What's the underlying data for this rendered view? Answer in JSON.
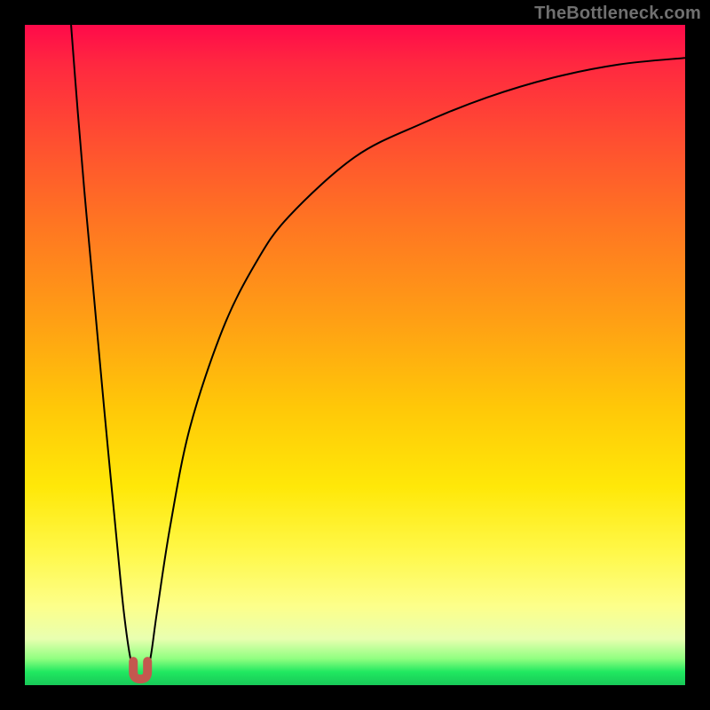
{
  "watermark": "TheBottleneck.com",
  "chart_data": {
    "type": "line",
    "title": "",
    "xlabel": "",
    "ylabel": "",
    "xlim": [
      0,
      100
    ],
    "ylim": [
      0,
      100
    ],
    "grid": false,
    "series": [
      {
        "name": "curve",
        "x": [
          7,
          8,
          9,
          10,
          12,
          14,
          15,
          16,
          17,
          18,
          19,
          20,
          22,
          25,
          30,
          35,
          40,
          50,
          60,
          70,
          80,
          90,
          100
        ],
        "values": [
          100,
          87,
          75,
          64,
          42,
          21,
          11,
          4,
          1,
          1,
          4,
          11,
          24,
          39,
          54,
          64,
          71,
          80,
          85,
          89,
          92,
          94,
          95
        ]
      }
    ],
    "marker": {
      "x": 17.5,
      "y": 2,
      "color": "#c4584f",
      "shape": "u"
    }
  }
}
